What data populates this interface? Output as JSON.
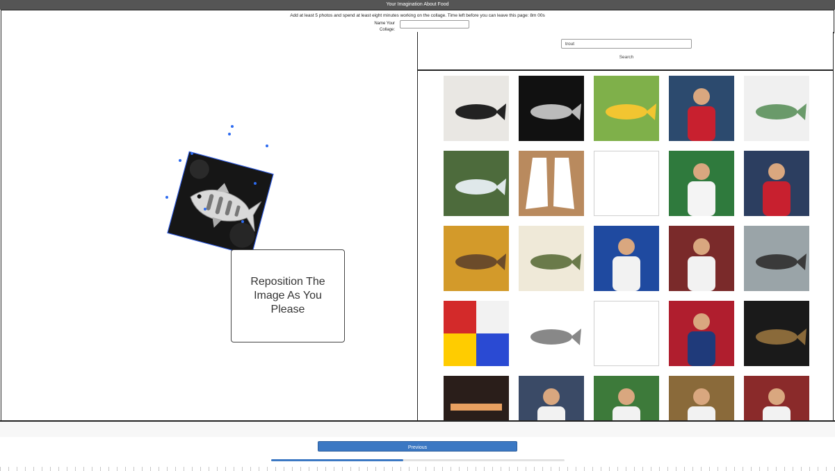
{
  "window": {
    "title": "Your Imagination About Food"
  },
  "header": {
    "instructions": "Add at least 5 photos and spend at least eight minutes working on the collage. Time left before you can leave this page: 8m 00s",
    "name_label": "Name Your Collage:",
    "name_value": ""
  },
  "canvas": {
    "placed_image": {
      "icon": "trout-photo",
      "rotation_deg": 15
    },
    "instruction_text": "Reposition The Image As You Please"
  },
  "search": {
    "query": "trout",
    "button_label": "Search"
  },
  "results": [
    {
      "kind": "framed-fish-print",
      "bg": "#e9e7e3",
      "fg": "#222222"
    },
    {
      "kind": "bw-fish",
      "bg": "#111111",
      "fg": "#bbbbbb"
    },
    {
      "kind": "book-cover",
      "bg": "#7fb04a",
      "fg": "#f2c531"
    },
    {
      "kind": "baseball-player",
      "bg": "#2c4a6e",
      "fg": "#c8202f"
    },
    {
      "kind": "fish-painting",
      "bg": "#f0f0f0",
      "fg": "#6a9a6a"
    },
    {
      "kind": "fishing-river",
      "bg": "#4d6b3c",
      "fg": "#dfe8ea"
    },
    {
      "kind": "cleats",
      "bg": "#b98a5e",
      "fg": "#ffffff"
    },
    {
      "kind": "blank",
      "bg": "#ffffff",
      "fg": "#ffffff"
    },
    {
      "kind": "baseball-player",
      "bg": "#2f7a3d",
      "fg": "#f4f4f4"
    },
    {
      "kind": "baseball-player",
      "bg": "#2c3e60",
      "fg": "#c8202f"
    },
    {
      "kind": "fisherman-autumn",
      "bg": "#d39a2a",
      "fg": "#6b4b2a"
    },
    {
      "kind": "trout-pattern",
      "bg": "#efe9d8",
      "fg": "#6a7a4a"
    },
    {
      "kind": "person-cap",
      "bg": "#1f4aa0",
      "fg": "#f2f2f2"
    },
    {
      "kind": "baseball-players",
      "bg": "#7a2a2a",
      "fg": "#f2f2f2"
    },
    {
      "kind": "fish-net",
      "bg": "#9aa4a8",
      "fg": "#3a3a3a"
    },
    {
      "kind": "color-grid",
      "bg": "#ffcc00",
      "fg": "#d32a2a"
    },
    {
      "kind": "fish-sketch",
      "bg": "#ffffff",
      "fg": "#888888"
    },
    {
      "kind": "blank",
      "bg": "#ffffff",
      "fg": "#ffffff"
    },
    {
      "kind": "press-conference",
      "bg": "#b01e2e",
      "fg": "#1f3a7a"
    },
    {
      "kind": "fish-in-net",
      "bg": "#1a1a1a",
      "fg": "#8a6a3a"
    },
    {
      "kind": "fly-tying",
      "bg": "#2a1e1a",
      "fg": "#e8a060"
    },
    {
      "kind": "baseball-player",
      "bg": "#3a4a66",
      "fg": "#f2f2f2"
    },
    {
      "kind": "baseball-player",
      "bg": "#3d7a3a",
      "fg": "#f2f2f2"
    },
    {
      "kind": "baseball-player",
      "bg": "#8a6a3a",
      "fg": "#f2f2f2"
    },
    {
      "kind": "baseball-team",
      "bg": "#8a2a2a",
      "fg": "#f2f2f2"
    }
  ],
  "footer": {
    "previous_label": "Previous",
    "progress": 0.45
  },
  "colors": {
    "titlebar": "#555555",
    "accent": "#3b78c3",
    "handle": "#2d6bf0"
  }
}
